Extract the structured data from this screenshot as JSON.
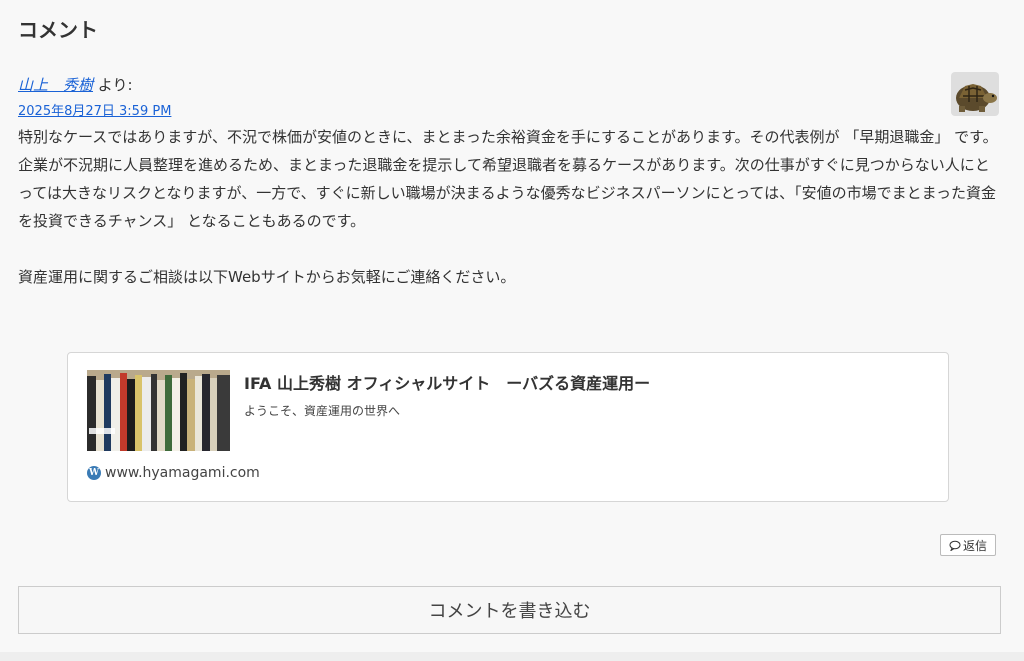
{
  "section": {
    "title": "コメント"
  },
  "comment": {
    "author": "山上　秀樹",
    "author_suffix": " より:",
    "date": "2025年8月27日 3:59 PM",
    "paragraphs": [
      "特別なケースではありますが、不況で株価が安値のときに、まとまった余裕資金を手にすることがあります。その代表例が 「早期退職金」 です。",
      "企業が不況期に人員整理を進めるため、まとまった退職金を提示して希望退職者を募るケースがあります。次の仕事がすぐに見つからない人にとっては大きなリスクとなりますが、一方で、すぐに新しい職場が決まるような優秀なビジネスパーソンにとっては、「安値の市場でまとまった資金を投資できるチャンス」 となることもあるのです。",
      "資産運用に関するご相談は以下Webサイトからお気軽にご連絡ください。"
    ]
  },
  "blogcard": {
    "title": "IFA 山上秀樹 オフィシャルサイト　ーバズる資産運用ー",
    "description": "ようこそ、資産運用の世界へ",
    "site": "www.hyamagami.com"
  },
  "reply_label": "返信",
  "write_comment_label": "コメントを書き込む",
  "colors": {
    "link": "#1a62d6",
    "text": "#333333",
    "background": "#f8f8f8"
  }
}
